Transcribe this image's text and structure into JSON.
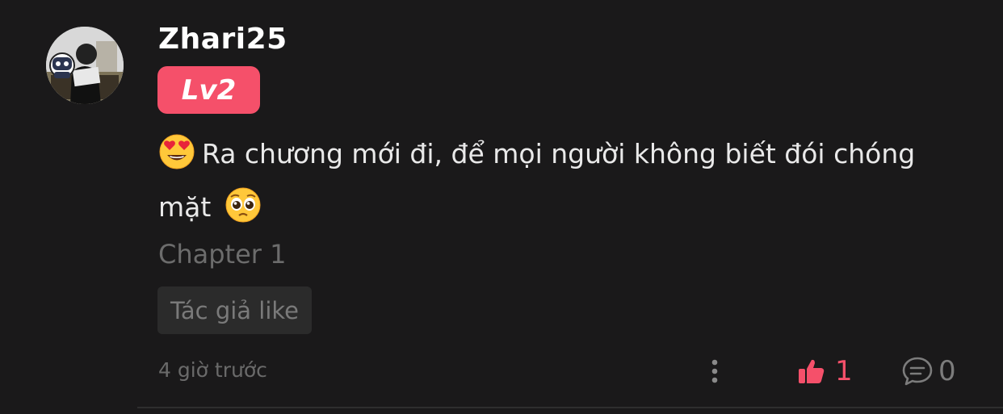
{
  "comment": {
    "username": "Zhari25",
    "level_badge": "Lv2",
    "text": "Ra chương mới đi, để mọi người không biết đói chóng mặt",
    "emoji_before": "heart-eyes-emoji",
    "emoji_after": "pleading-face-emoji",
    "chapter": "Chapter 1",
    "author_like_label": "Tác giả like",
    "time": "4 giờ trước",
    "like_count": "1",
    "reply_count": "0"
  },
  "colors": {
    "background": "#1a191a",
    "badge": "#f5506a",
    "like_accent": "#f5506a",
    "muted_text": "#6c6c6c"
  },
  "icons": {
    "more": "vertical-dots-icon",
    "like": "thumbs-up-icon",
    "reply": "speech-bubble-icon"
  }
}
